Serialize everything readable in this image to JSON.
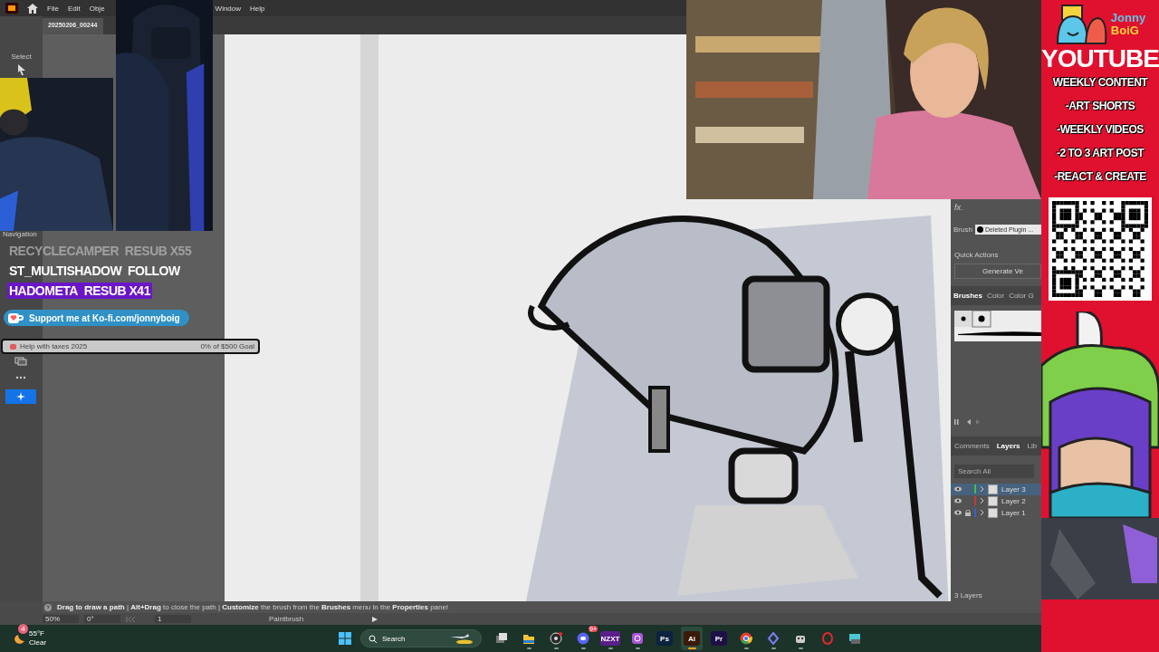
{
  "menu_bar": {
    "items": [
      "File",
      "Edit",
      "Obje",
      "Window",
      "Help"
    ]
  },
  "document_tab": {
    "title": "20250206_00244"
  },
  "toolbar": {
    "select_label": "Select",
    "nav_label": "Navigation"
  },
  "alerts": [
    {
      "user": "RECYCLECAMPER",
      "action": "RESUB X55",
      "kind": "faded"
    },
    {
      "user": "ST_MULTISHADOW",
      "action": "FOLLOW",
      "kind": "plain"
    },
    {
      "user": "HADOMETA",
      "action": "RESUB X41",
      "kind": "highlight"
    }
  ],
  "kofi": {
    "text": "Support me at Ko-fi.com/jonnyboig"
  },
  "goal": {
    "title": "Help with taxes 2025",
    "progress": "0% of $500 Goal",
    "level": 0
  },
  "properties_panel": {
    "fx": "fx.",
    "brush_label": "Brush",
    "brush_value": "Deleted Plugin ...",
    "quick_actions": "Quick Actions",
    "action_button": "Generate Ve"
  },
  "brushes_panel": {
    "tabs": [
      {
        "label": "Brushes",
        "selected": true
      },
      {
        "label": "Color",
        "selected": false
      },
      {
        "label": "Color G",
        "selected": false
      }
    ]
  },
  "layers_panel": {
    "tabs": [
      {
        "label": "Comments",
        "selected": false
      },
      {
        "label": "Layers",
        "selected": true
      },
      {
        "label": "Lib",
        "selected": false
      }
    ],
    "search_placeholder": "Search All",
    "layers": [
      {
        "name": "Layer 3",
        "color": "#3fc14a",
        "selected": true,
        "locked": false
      },
      {
        "name": "Layer 2",
        "color": "#c8363a",
        "selected": false,
        "locked": false
      },
      {
        "name": "Layer 1",
        "color": "#3a5fd0",
        "selected": false,
        "locked": true
      }
    ],
    "count": "3 Layers"
  },
  "status_bar": {
    "hint": "**Drag to draw a path** | **Alt+Drag** to close the path | **Customize** the brush from the **Brushes** menu in the **Properties** panel",
    "zoom": "50%",
    "rotation": "0°",
    "artboard": "1",
    "tool": "Paintbrush"
  },
  "taskbar": {
    "weather": {
      "badge": "4",
      "temp": "55°F",
      "condition": "Clear"
    },
    "search": {
      "placeholder": "Search"
    },
    "apps": [
      {
        "kind": "task-view",
        "selected": false,
        "running": false
      },
      {
        "kind": "folder",
        "selected": false,
        "running": true
      },
      {
        "kind": "obs",
        "selected": false,
        "running": true
      },
      {
        "kind": "chat",
        "badge": "9+",
        "selected": false,
        "running": true
      },
      {
        "kind": "tile",
        "label": "NZXT",
        "color": "#5b1f8a",
        "selected": false,
        "running": true
      },
      {
        "kind": "camera",
        "selected": false,
        "running": true
      },
      {
        "kind": "tile",
        "label": "Ps",
        "color": "#0b2240",
        "selected": false,
        "running": false
      },
      {
        "kind": "tile",
        "label": "Ai",
        "color": "#3a1a06",
        "selected": true,
        "running": true
      },
      {
        "kind": "tile",
        "label": "Pr",
        "color": "#1e1046",
        "selected": false,
        "running": false
      },
      {
        "kind": "browser",
        "selected": false,
        "running": true
      },
      {
        "kind": "diamond",
        "selected": false,
        "running": true
      },
      {
        "kind": "robot",
        "selected": false,
        "running": true
      },
      {
        "kind": "ring",
        "selected": false,
        "running": false
      },
      {
        "kind": "screen",
        "selected": false,
        "running": false
      }
    ]
  },
  "promo": {
    "logo_top": "Jonny",
    "logo_bottom": "BoiG",
    "title": "YOUTUBE",
    "lines": [
      "WEEKLY CONTENT",
      "-ART SHORTS",
      "-WEEKLY VIDEOS",
      "-2 TO 3 ART POST",
      "-REACT & CREATE"
    ]
  }
}
